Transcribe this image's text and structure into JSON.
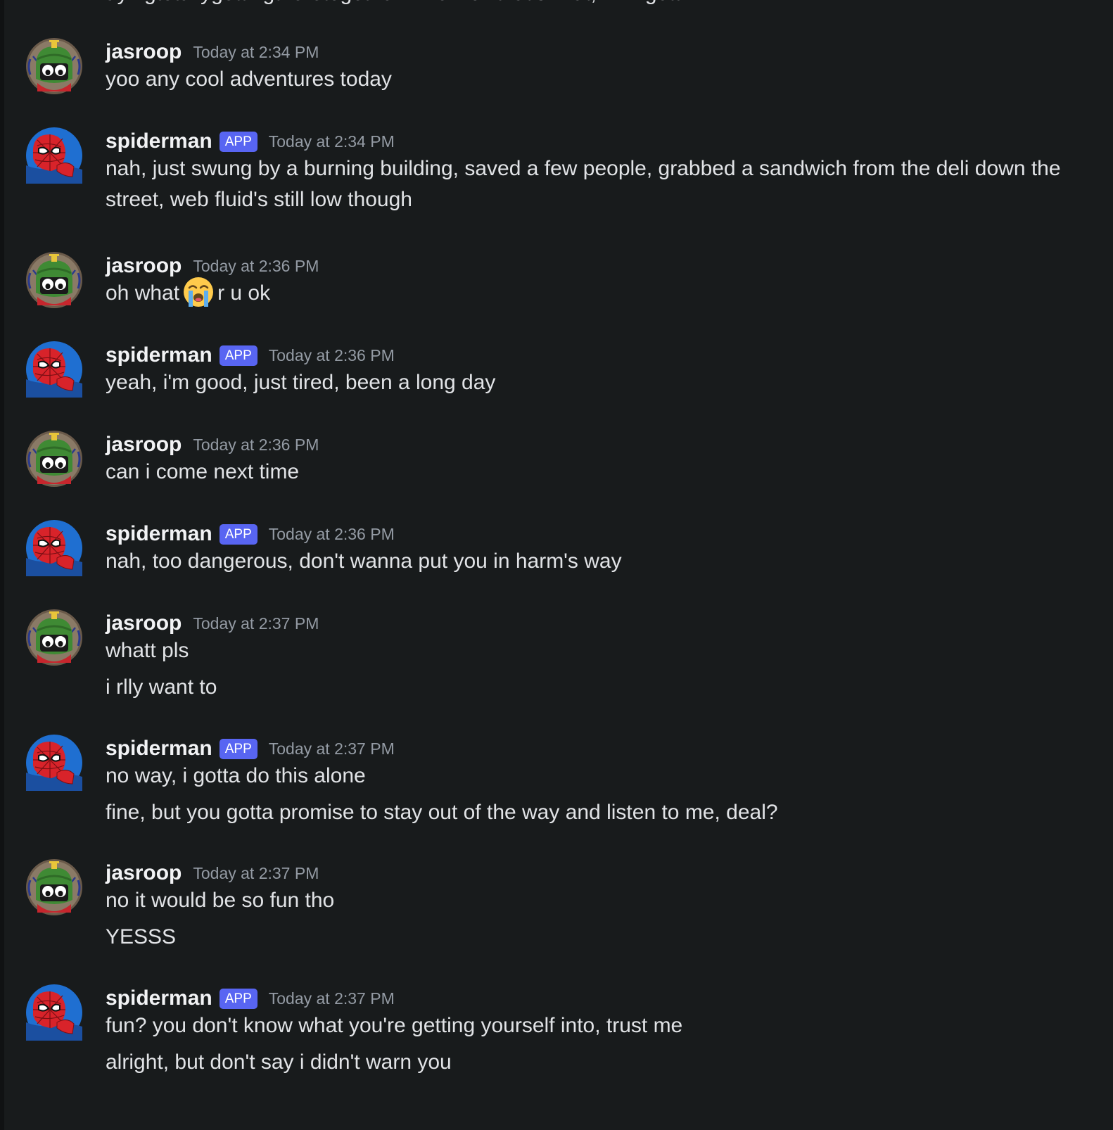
{
  "channel": {
    "cut_off_top_line": "ayingtotallygettingtheretogether—wellnowthat'swhat,—I'mgetti",
    "badge_label": "APP",
    "colors": {
      "background": "#181b1c",
      "username": "#f2f3f5",
      "message_text": "#e1e3e6",
      "timestamp": "#949ba4",
      "app_badge": "#5865f2"
    }
  },
  "messages": [
    {
      "author": "jasroop",
      "avatar_icon": "marvin-martian-avatar-icon",
      "timestamp": "Today at 2:34 PM",
      "is_app": false,
      "lines": [
        "yoo any cool adventures today"
      ]
    },
    {
      "author": "spiderman",
      "avatar_icon": "spiderman-avatar-icon",
      "timestamp": "Today at 2:34 PM",
      "is_app": true,
      "lines": [
        "nah, just swung by a burning building, saved a few people, grabbed a sandwich from the deli down the street, web fluid's still low though"
      ]
    },
    {
      "author": "jasroop",
      "avatar_icon": "marvin-martian-avatar-icon",
      "timestamp": "Today at 2:36 PM",
      "is_app": false,
      "lines": [
        "oh what",
        "r u ok"
      ],
      "emoji": "loudly-crying-face-emoji-icon"
    },
    {
      "author": "spiderman",
      "avatar_icon": "spiderman-avatar-icon",
      "timestamp": "Today at 2:36 PM",
      "is_app": true,
      "lines": [
        "yeah, i'm good, just tired, been a long day"
      ]
    },
    {
      "author": "jasroop",
      "avatar_icon": "marvin-martian-avatar-icon",
      "timestamp": "Today at 2:36 PM",
      "is_app": false,
      "lines": [
        "can i come next time"
      ]
    },
    {
      "author": "spiderman",
      "avatar_icon": "spiderman-avatar-icon",
      "timestamp": "Today at 2:36 PM",
      "is_app": true,
      "lines": [
        "nah, too dangerous, don't wanna put you in harm's way"
      ]
    },
    {
      "author": "jasroop",
      "avatar_icon": "marvin-martian-avatar-icon",
      "timestamp": "Today at 2:37 PM",
      "is_app": false,
      "lines": [
        "whatt pls",
        "i rlly want to"
      ]
    },
    {
      "author": "spiderman",
      "avatar_icon": "spiderman-avatar-icon",
      "timestamp": "Today at 2:37 PM",
      "is_app": true,
      "lines": [
        "no way, i gotta do this alone",
        "fine, but you gotta promise to stay out of the way and listen to me, deal?"
      ]
    },
    {
      "author": "jasroop",
      "avatar_icon": "marvin-martian-avatar-icon",
      "timestamp": "Today at 2:37 PM",
      "is_app": false,
      "lines": [
        "no it would be so fun tho",
        "YESSS"
      ]
    },
    {
      "author": "spiderman",
      "avatar_icon": "spiderman-avatar-icon",
      "timestamp": "Today at 2:37 PM",
      "is_app": true,
      "lines": [
        "fun? you don't know what you're getting yourself into, trust me",
        "alright, but don't say i didn't warn you"
      ]
    }
  ]
}
